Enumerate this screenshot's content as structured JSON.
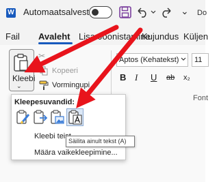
{
  "titlebar": {
    "logo_letter": "W",
    "autosave_label": "Automaatsalvestus",
    "right_edge_text": "Do"
  },
  "tabs": [
    {
      "label": "Fail"
    },
    {
      "label": "Avaleht",
      "active": true
    },
    {
      "label": "Lisa"
    },
    {
      "label": "Joonistamine"
    },
    {
      "label": "Kujundus"
    },
    {
      "label": "Küljen"
    }
  ],
  "clipboard": {
    "paste_label": "Kleebi",
    "copy_label": "Kopeeri",
    "format_painter_label": "Vormingupi"
  },
  "font": {
    "font_name": "Aptos (Kehatekst)",
    "font_size": "11",
    "group_label": "Font",
    "format_buttons": [
      "B",
      "I",
      "U",
      "ab",
      "x₂"
    ]
  },
  "paste_menu": {
    "header": "Kleepesuvandid:",
    "options": [
      {
        "icon": "paste-keep-source-icon"
      },
      {
        "icon": "paste-merge-icon"
      },
      {
        "icon": "paste-picture-icon"
      },
      {
        "icon": "paste-text-only-icon",
        "selected": true
      }
    ],
    "items": [
      "Kleebi teist",
      "Määra vaikekleepimine..."
    ],
    "tooltip": "Säilita ainult tekst (A)"
  },
  "colors": {
    "accent": "#185abd",
    "annotation_arrow": "#e8141c",
    "save_icon": "#7a3e9d"
  }
}
